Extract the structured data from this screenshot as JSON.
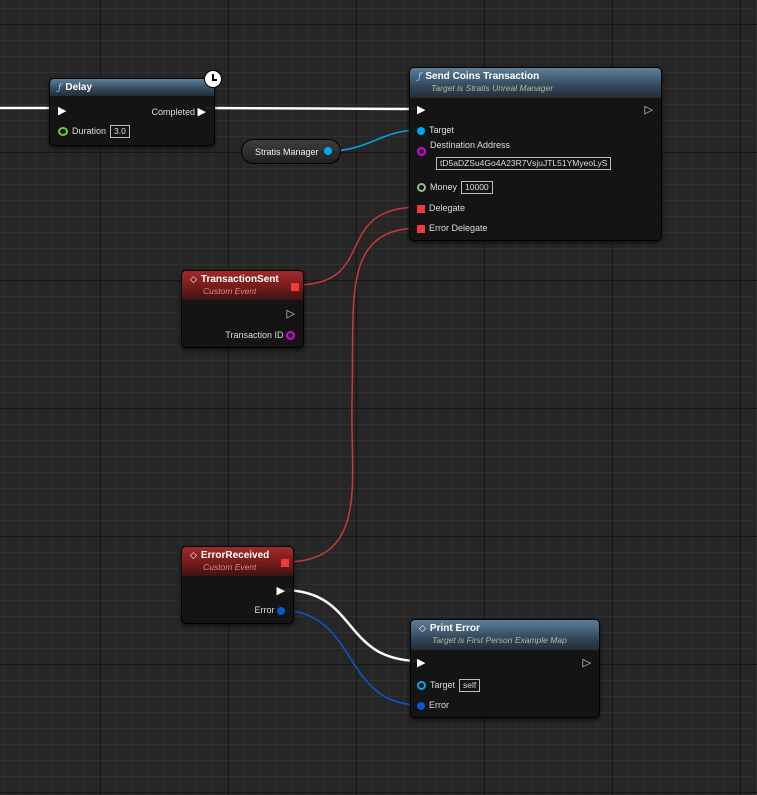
{
  "delay_node": {
    "title": "Delay",
    "completed_label": "Completed",
    "duration_label": "Duration",
    "duration_value": "3.0"
  },
  "stratis_manager": {
    "label": "Stratis Manager"
  },
  "send_coins": {
    "title": "Send Coins Transaction",
    "subtitle": "Target is Stratis Unreal Manager",
    "target_label": "Target",
    "dest_label": "Destination Address",
    "dest_value": "tD5aDZSu4Go4A23R7VsjuJTL51YMyeoLyS",
    "money_label": "Money",
    "money_value": "10000",
    "delegate_label": "Delegate",
    "error_delegate_label": "Error Delegate"
  },
  "transaction_sent": {
    "title": "TransactionSent",
    "subtitle": "Custom Event",
    "tx_id_label": "Transaction ID"
  },
  "error_received": {
    "title": "ErrorReceived",
    "subtitle": "Custom Event",
    "error_label": "Error"
  },
  "print_error": {
    "title": "Print Error",
    "subtitle": "Target is First Person Example Map",
    "target_label": "Target",
    "target_value": "self",
    "error_label": "Error"
  },
  "colors": {
    "exec": "#ffffff",
    "object": "#00a8f2",
    "string": "#e000e0",
    "integer": "#8fbf8f",
    "float": "#6fd020",
    "delegate": "#ef3a3a",
    "error_struct": "#0a58d0"
  }
}
